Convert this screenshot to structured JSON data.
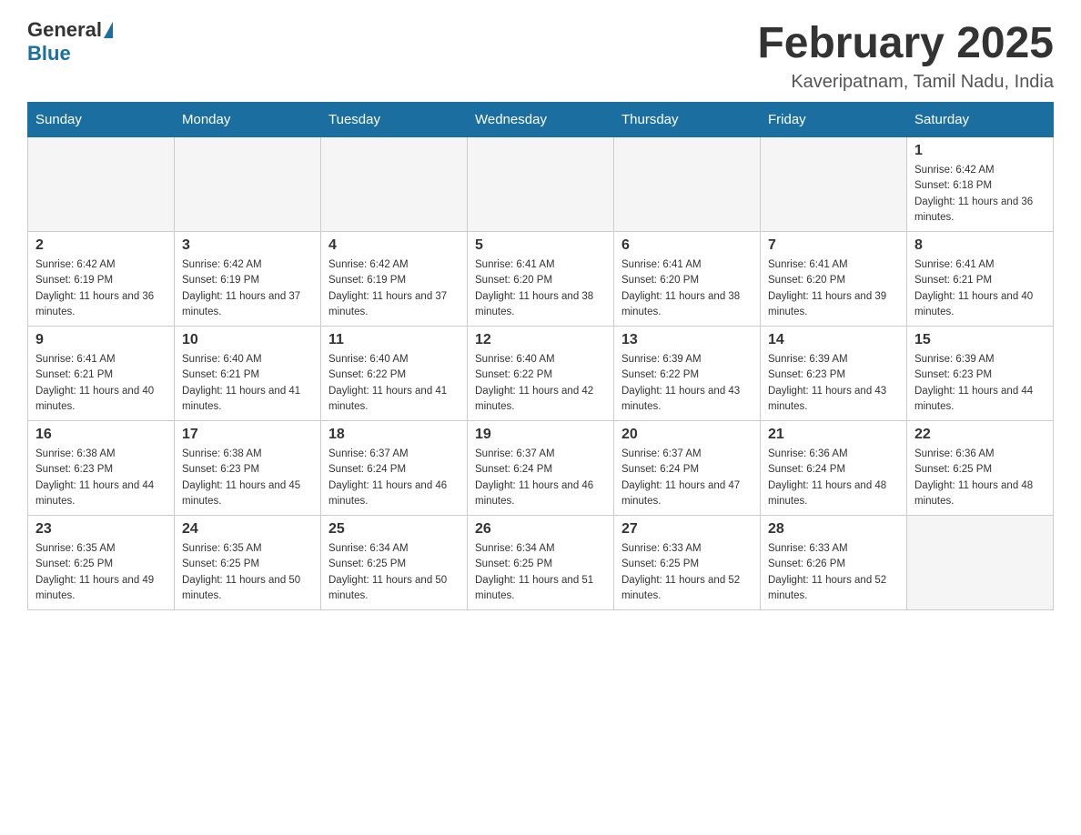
{
  "header": {
    "logo_general": "General",
    "logo_blue": "Blue",
    "title": "February 2025",
    "subtitle": "Kaveripatnam, Tamil Nadu, India"
  },
  "days_of_week": [
    "Sunday",
    "Monday",
    "Tuesday",
    "Wednesday",
    "Thursday",
    "Friday",
    "Saturday"
  ],
  "weeks": [
    [
      {
        "day": "",
        "info": ""
      },
      {
        "day": "",
        "info": ""
      },
      {
        "day": "",
        "info": ""
      },
      {
        "day": "",
        "info": ""
      },
      {
        "day": "",
        "info": ""
      },
      {
        "day": "",
        "info": ""
      },
      {
        "day": "1",
        "info": "Sunrise: 6:42 AM\nSunset: 6:18 PM\nDaylight: 11 hours and 36 minutes."
      }
    ],
    [
      {
        "day": "2",
        "info": "Sunrise: 6:42 AM\nSunset: 6:19 PM\nDaylight: 11 hours and 36 minutes."
      },
      {
        "day": "3",
        "info": "Sunrise: 6:42 AM\nSunset: 6:19 PM\nDaylight: 11 hours and 37 minutes."
      },
      {
        "day": "4",
        "info": "Sunrise: 6:42 AM\nSunset: 6:19 PM\nDaylight: 11 hours and 37 minutes."
      },
      {
        "day": "5",
        "info": "Sunrise: 6:41 AM\nSunset: 6:20 PM\nDaylight: 11 hours and 38 minutes."
      },
      {
        "day": "6",
        "info": "Sunrise: 6:41 AM\nSunset: 6:20 PM\nDaylight: 11 hours and 38 minutes."
      },
      {
        "day": "7",
        "info": "Sunrise: 6:41 AM\nSunset: 6:20 PM\nDaylight: 11 hours and 39 minutes."
      },
      {
        "day": "8",
        "info": "Sunrise: 6:41 AM\nSunset: 6:21 PM\nDaylight: 11 hours and 40 minutes."
      }
    ],
    [
      {
        "day": "9",
        "info": "Sunrise: 6:41 AM\nSunset: 6:21 PM\nDaylight: 11 hours and 40 minutes."
      },
      {
        "day": "10",
        "info": "Sunrise: 6:40 AM\nSunset: 6:21 PM\nDaylight: 11 hours and 41 minutes."
      },
      {
        "day": "11",
        "info": "Sunrise: 6:40 AM\nSunset: 6:22 PM\nDaylight: 11 hours and 41 minutes."
      },
      {
        "day": "12",
        "info": "Sunrise: 6:40 AM\nSunset: 6:22 PM\nDaylight: 11 hours and 42 minutes."
      },
      {
        "day": "13",
        "info": "Sunrise: 6:39 AM\nSunset: 6:22 PM\nDaylight: 11 hours and 43 minutes."
      },
      {
        "day": "14",
        "info": "Sunrise: 6:39 AM\nSunset: 6:23 PM\nDaylight: 11 hours and 43 minutes."
      },
      {
        "day": "15",
        "info": "Sunrise: 6:39 AM\nSunset: 6:23 PM\nDaylight: 11 hours and 44 minutes."
      }
    ],
    [
      {
        "day": "16",
        "info": "Sunrise: 6:38 AM\nSunset: 6:23 PM\nDaylight: 11 hours and 44 minutes."
      },
      {
        "day": "17",
        "info": "Sunrise: 6:38 AM\nSunset: 6:23 PM\nDaylight: 11 hours and 45 minutes."
      },
      {
        "day": "18",
        "info": "Sunrise: 6:37 AM\nSunset: 6:24 PM\nDaylight: 11 hours and 46 minutes."
      },
      {
        "day": "19",
        "info": "Sunrise: 6:37 AM\nSunset: 6:24 PM\nDaylight: 11 hours and 46 minutes."
      },
      {
        "day": "20",
        "info": "Sunrise: 6:37 AM\nSunset: 6:24 PM\nDaylight: 11 hours and 47 minutes."
      },
      {
        "day": "21",
        "info": "Sunrise: 6:36 AM\nSunset: 6:24 PM\nDaylight: 11 hours and 48 minutes."
      },
      {
        "day": "22",
        "info": "Sunrise: 6:36 AM\nSunset: 6:25 PM\nDaylight: 11 hours and 48 minutes."
      }
    ],
    [
      {
        "day": "23",
        "info": "Sunrise: 6:35 AM\nSunset: 6:25 PM\nDaylight: 11 hours and 49 minutes."
      },
      {
        "day": "24",
        "info": "Sunrise: 6:35 AM\nSunset: 6:25 PM\nDaylight: 11 hours and 50 minutes."
      },
      {
        "day": "25",
        "info": "Sunrise: 6:34 AM\nSunset: 6:25 PM\nDaylight: 11 hours and 50 minutes."
      },
      {
        "day": "26",
        "info": "Sunrise: 6:34 AM\nSunset: 6:25 PM\nDaylight: 11 hours and 51 minutes."
      },
      {
        "day": "27",
        "info": "Sunrise: 6:33 AM\nSunset: 6:25 PM\nDaylight: 11 hours and 52 minutes."
      },
      {
        "day": "28",
        "info": "Sunrise: 6:33 AM\nSunset: 6:26 PM\nDaylight: 11 hours and 52 minutes."
      },
      {
        "day": "",
        "info": ""
      }
    ]
  ]
}
